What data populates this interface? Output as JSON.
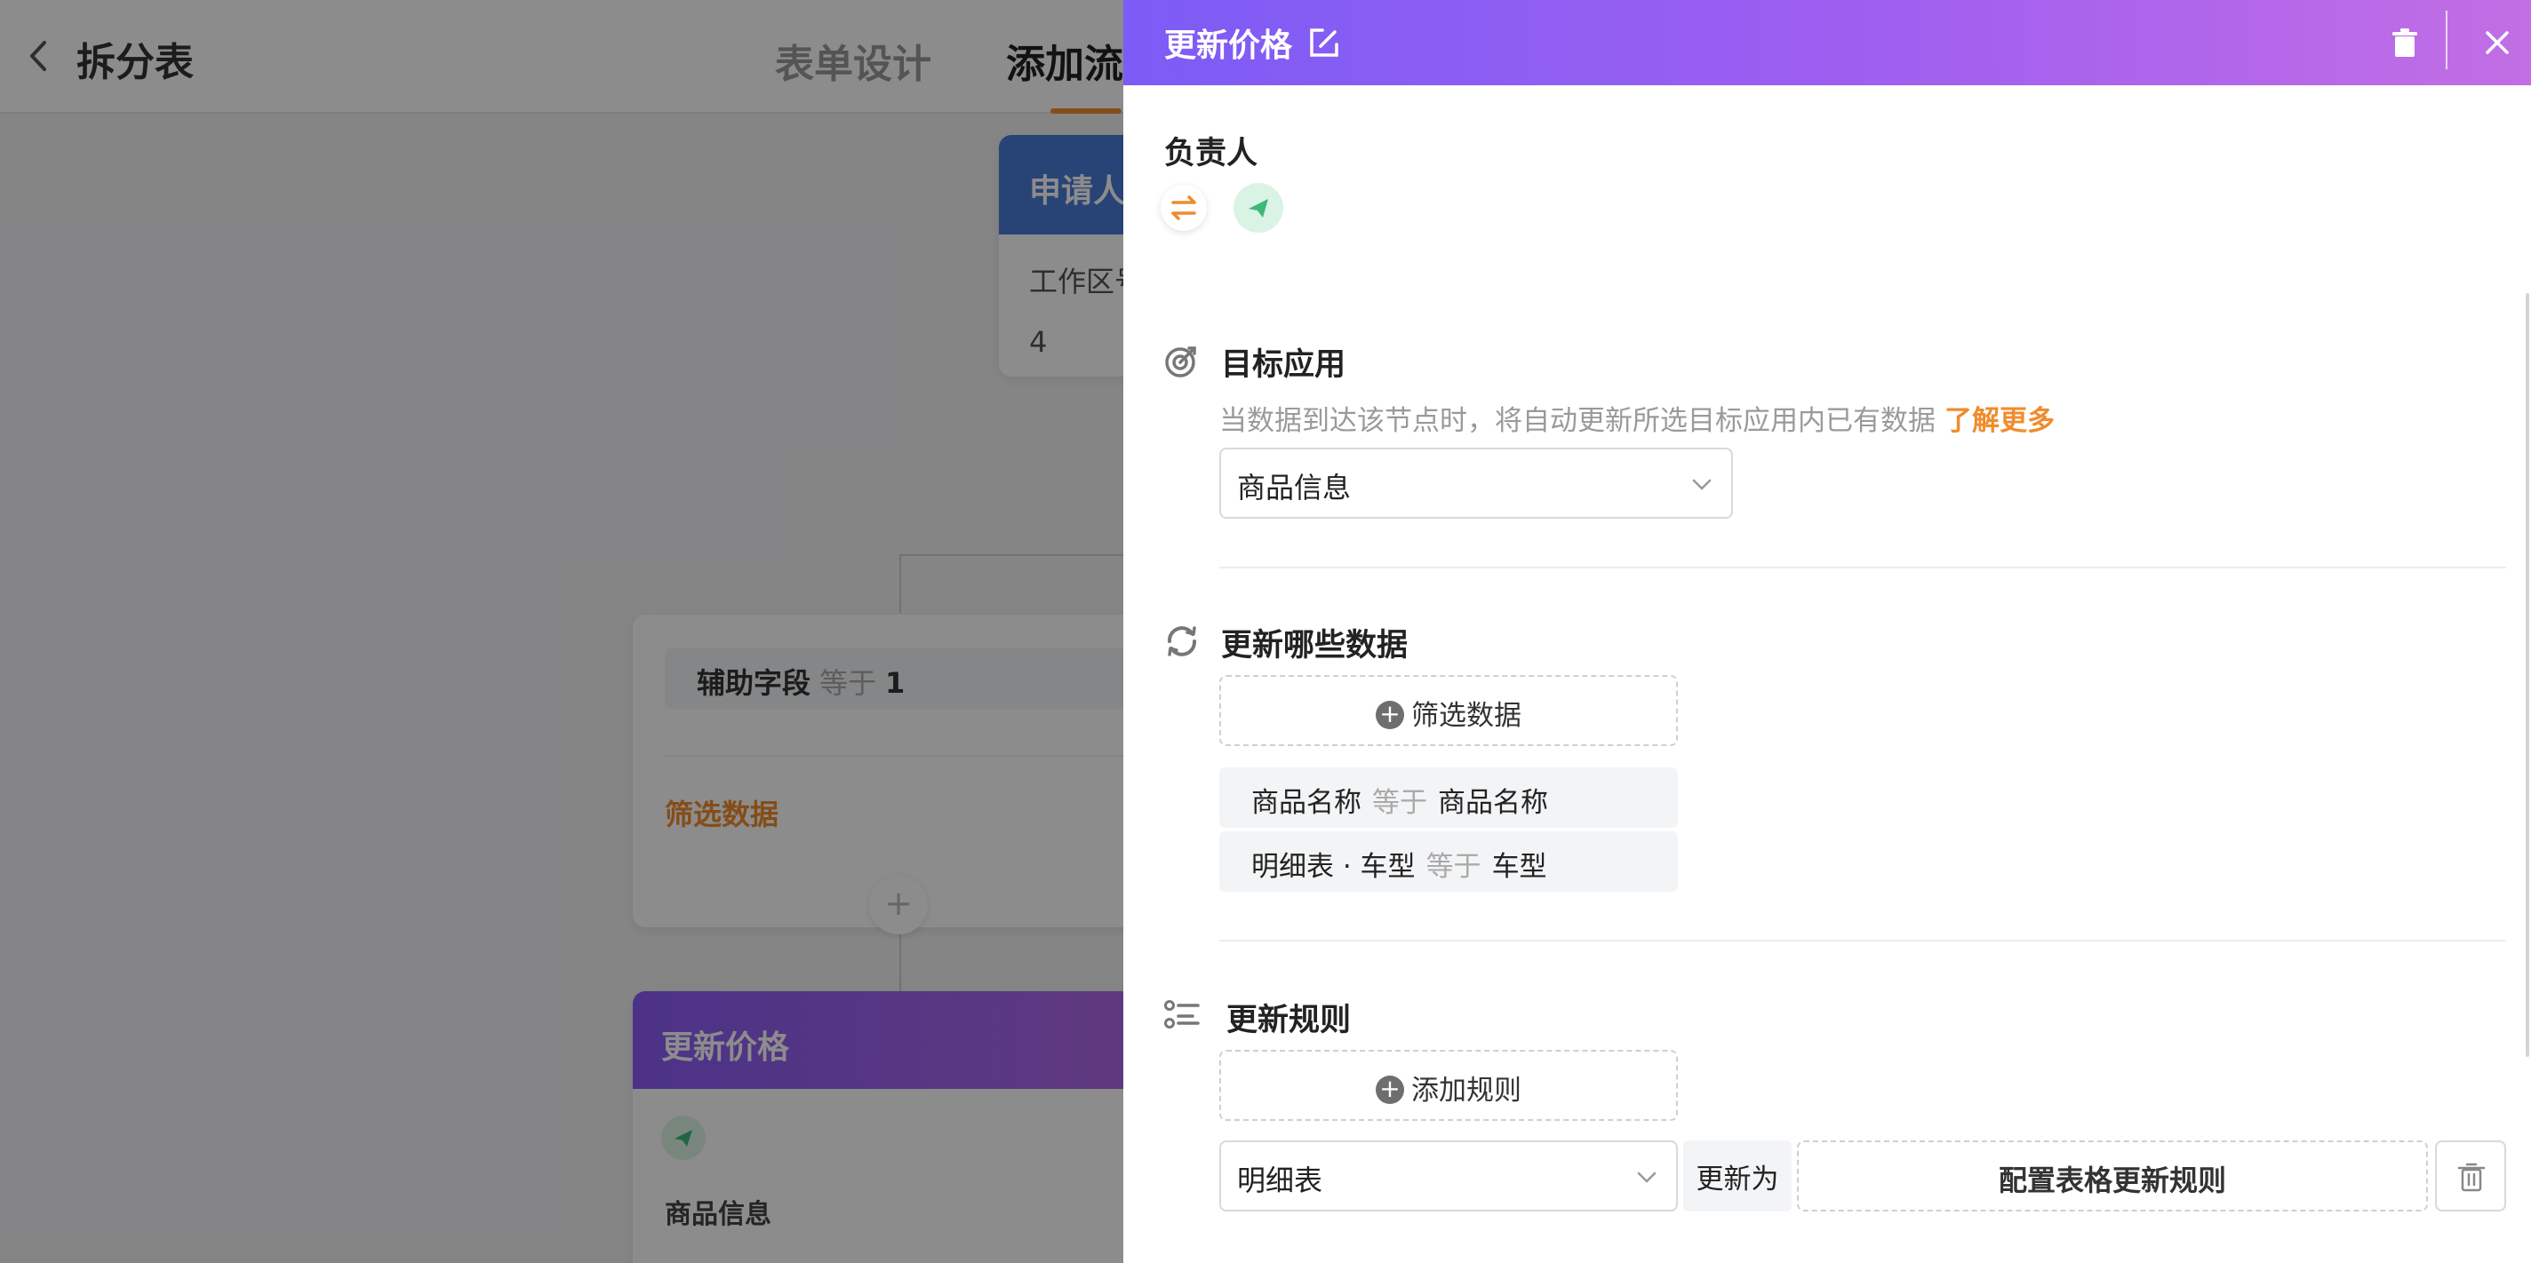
{
  "header": {
    "back_icon": "chevron-left-icon",
    "title": "拆分表",
    "tabs": [
      {
        "label": "表单设计",
        "active": false
      },
      {
        "label": "添加流",
        "active": true
      }
    ]
  },
  "canvas": {
    "applicant_card": {
      "title": "申请人",
      "body": "工作区号",
      "meta": "4"
    },
    "filter_card": {
      "condition": {
        "field": "辅助字段",
        "op": "等于",
        "value": "1"
      },
      "filter_label": "筛选数据"
    },
    "add_node_label": "+",
    "update_card": {
      "title": "更新价格",
      "info": "商品信息"
    }
  },
  "drawer": {
    "title": "更新价格",
    "colors": {
      "header_start": "#7c5cf5",
      "header_end": "#c26ee4",
      "accent": "#f08c2d"
    },
    "owner": {
      "label": "负责人",
      "icons": [
        "transfer-icon",
        "send-icon"
      ]
    },
    "target_app": {
      "label": "目标应用",
      "description": "当数据到达该节点时，将自动更新所选目标应用内已有数据",
      "learn_more": "了解更多",
      "selected": "商品信息"
    },
    "which_data": {
      "label": "更新哪些数据",
      "filter_button": "筛选数据",
      "conditions": [
        {
          "field": "商品名称",
          "op": "等于",
          "value": "商品名称"
        },
        {
          "field": "明细表 · 车型",
          "op": "等于",
          "value": "车型"
        }
      ]
    },
    "rules": {
      "label": "更新规则",
      "add_button": "添加规则",
      "rule": {
        "field": "明细表",
        "update_to": "更新为",
        "config_button": "配置表格更新规则"
      }
    }
  }
}
